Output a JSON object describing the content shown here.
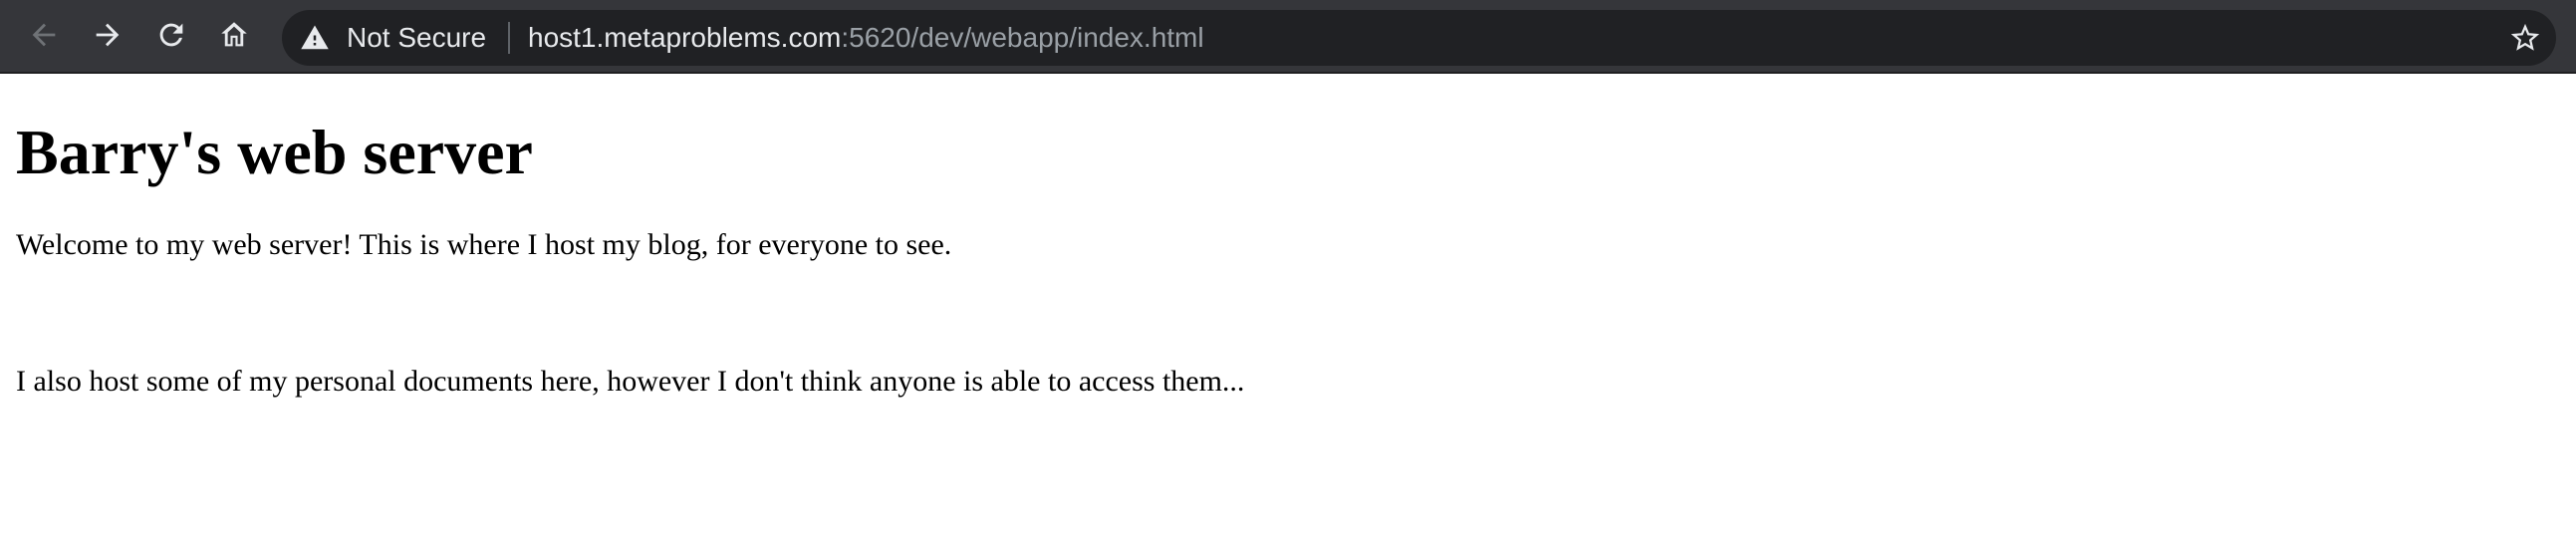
{
  "browser": {
    "security_label": "Not Secure",
    "url_host": "host1.metaproblems.com",
    "url_rest": ":5620/dev/webapp/index.html",
    "colors": {
      "toolbar": "#35363a",
      "omnibox": "#202124",
      "text_primary": "#e8eaed",
      "text_secondary": "#9aa0a6"
    },
    "icons": [
      "back-arrow-icon",
      "forward-arrow-icon",
      "reload-icon",
      "home-icon",
      "warning-icon",
      "bookmark-star-icon"
    ]
  },
  "page": {
    "heading": "Barry's web server",
    "paragraphs": [
      "Welcome to my web server! This is where I host my blog, for everyone to see.",
      "I also host some of my personal documents here, however I don't think anyone is able to access them..."
    ]
  }
}
